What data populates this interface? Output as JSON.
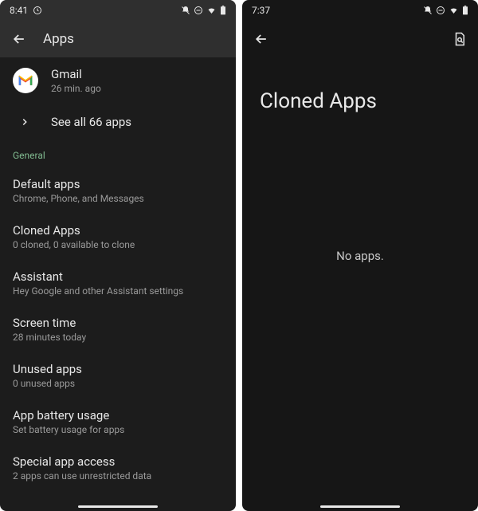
{
  "left": {
    "status_time": "8:41",
    "header_title": "Apps",
    "recent_app": {
      "name": "Gmail",
      "sub": "26 min. ago"
    },
    "see_all": "See all 66 apps",
    "section_general": "General",
    "settings": [
      {
        "title": "Default apps",
        "sub": "Chrome, Phone, and Messages"
      },
      {
        "title": "Cloned Apps",
        "sub": "0 cloned, 0 available to clone"
      },
      {
        "title": "Assistant",
        "sub": "Hey Google and other Assistant settings"
      },
      {
        "title": "Screen time",
        "sub": "28 minutes today"
      },
      {
        "title": "Unused apps",
        "sub": "0 unused apps"
      },
      {
        "title": "App battery usage",
        "sub": "Set battery usage for apps"
      },
      {
        "title": "Special app access",
        "sub": "2 apps can use unrestricted data"
      }
    ]
  },
  "right": {
    "status_time": "7:37",
    "page_title": "Cloned Apps",
    "empty_text": "No apps."
  }
}
